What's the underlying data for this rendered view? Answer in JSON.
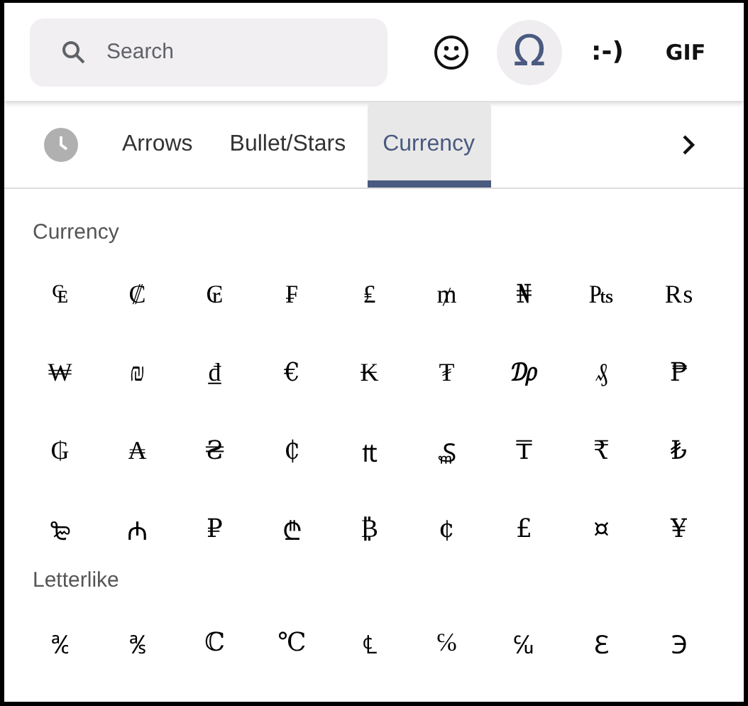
{
  "search": {
    "placeholder": "Search"
  },
  "modes": [
    {
      "kind": "emoji",
      "selected": false
    },
    {
      "kind": "symbols",
      "label": "Ω",
      "selected": true
    },
    {
      "kind": "emoticons",
      "label": ":-)",
      "selected": false
    },
    {
      "kind": "gif",
      "label": "GIF",
      "selected": false
    }
  ],
  "tabs": [
    {
      "kind": "recent",
      "selected": false
    },
    {
      "label": "Arrows",
      "selected": false
    },
    {
      "label": "Bullet/Stars",
      "selected": false
    },
    {
      "label": "Currency",
      "selected": true
    }
  ],
  "sections": [
    {
      "title": "Currency",
      "symbols": [
        "₠",
        "₡",
        "₢",
        "₣",
        "₤",
        "₥",
        "₦",
        "₧",
        "₨",
        "₩",
        "₪",
        "₫",
        "€",
        "₭",
        "₮",
        "₯",
        "₰",
        "₱",
        "₲",
        "₳",
        "₴",
        "₵",
        "₶",
        "₷",
        "₸",
        "₹",
        "₺",
        "₻",
        "₼",
        "₽",
        "₾",
        "₿",
        "¢",
        "£",
        "¤",
        "¥"
      ]
    },
    {
      "title": "Letterlike",
      "symbols": [
        "℀",
        "℁",
        "ℂ",
        "℃",
        "℄",
        "℅",
        "℆",
        "ℇ",
        "℈"
      ]
    }
  ]
}
